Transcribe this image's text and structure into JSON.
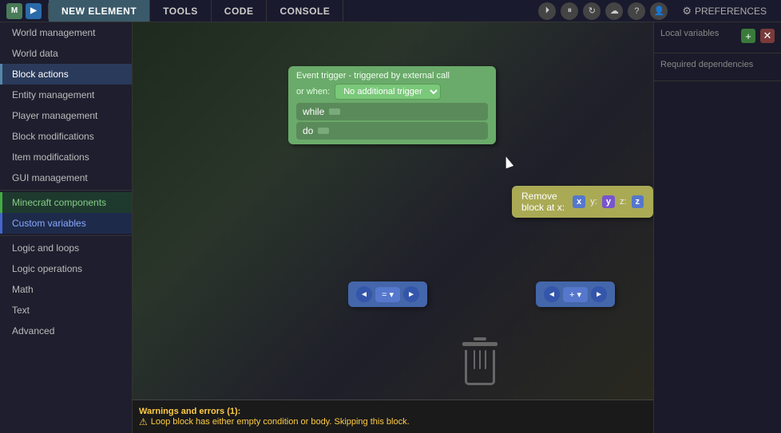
{
  "topbar": {
    "tabs": [
      {
        "id": "new-element",
        "label": "NEW ELEMENT",
        "active": true
      },
      {
        "id": "tools",
        "label": "TOOLS",
        "active": false
      },
      {
        "id": "code",
        "label": "CODE",
        "active": false
      },
      {
        "id": "console",
        "label": "CONSOLE",
        "active": false
      }
    ],
    "preferences_label": "PREFERENCES"
  },
  "sidebar": {
    "items": [
      {
        "id": "world-management",
        "label": "World management",
        "active": false
      },
      {
        "id": "world-data",
        "label": "World data",
        "active": false
      },
      {
        "id": "block-actions",
        "label": "Block actions",
        "active": true
      },
      {
        "id": "entity-management",
        "label": "Entity management",
        "active": false
      },
      {
        "id": "player-management",
        "label": "Player management",
        "active": false
      },
      {
        "id": "block-modifications",
        "label": "Block modifications",
        "active": false
      },
      {
        "id": "item-modifications",
        "label": "Item modifications",
        "active": false
      },
      {
        "id": "gui-management",
        "label": "GUI management",
        "active": false
      },
      {
        "id": "minecraft-components",
        "label": "Minecraft components",
        "highlight": true
      },
      {
        "id": "custom-variables",
        "label": "Custom variables",
        "highlight2": true
      },
      {
        "id": "logic-and-loops",
        "label": "Logic and loops",
        "active": false
      },
      {
        "id": "logic-operations",
        "label": "Logic operations",
        "active": false
      },
      {
        "id": "math",
        "label": "Math",
        "active": false
      },
      {
        "id": "text",
        "label": "Text",
        "active": false
      },
      {
        "id": "advanced",
        "label": "Advanced",
        "active": false
      }
    ]
  },
  "canvas": {
    "event_block": {
      "title": "Event trigger - triggered by external call",
      "or_when_label": "or when:",
      "trigger_value": "No additional trigger",
      "while_label": "while",
      "do_label": "do"
    },
    "remove_block": {
      "label": "Remove block at x:",
      "x_label": "x",
      "x_coord": "x",
      "y_label": "y:",
      "y_coord": "y",
      "z_label": "z:",
      "z_coord": "z"
    }
  },
  "right_panel": {
    "local_variables": {
      "title": "Local variables",
      "add_label": "+",
      "remove_label": "✕"
    },
    "required_dependencies": {
      "title": "Required dependencies"
    }
  },
  "status_bar": {
    "warnings_title": "Warnings and errors (1):",
    "error_text": "Loop block has either empty condition or body. Skipping this block."
  }
}
